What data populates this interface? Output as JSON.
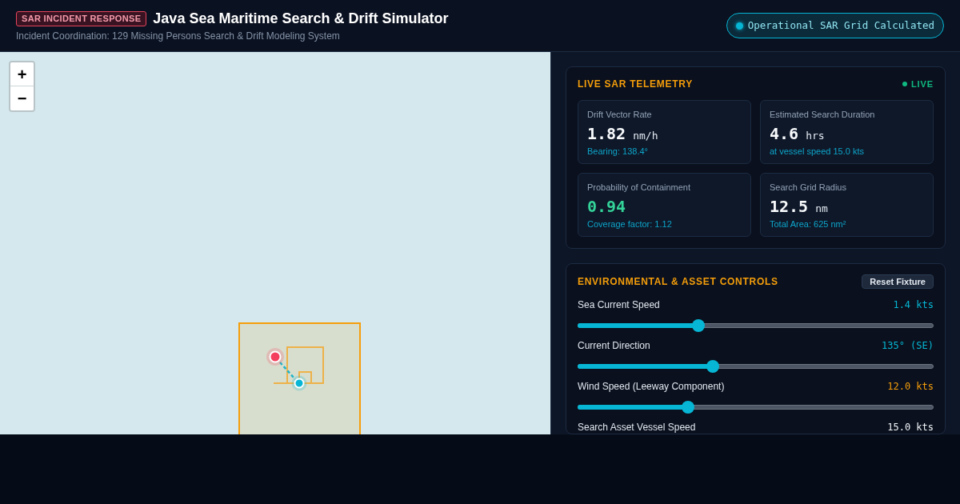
{
  "header": {
    "badge": "SAR INCIDENT RESPONSE",
    "title": "Java Sea Maritime Search & Drift Simulator",
    "subtitle": "Incident Coordination: 129 Missing Persons Search & Drift Modeling System",
    "status": "Operational SAR Grid Calculated"
  },
  "map": {
    "zoom_buttons": [
      "+",
      "−"
    ]
  },
  "telemetry": {
    "title": "LIVE SAR TELEMETRY",
    "live": "LIVE",
    "stats": [
      {
        "label": "Drift Vector Rate",
        "value": "1.82",
        "unit": "nm/h",
        "note": "Bearing: 138.4°",
        "color": "#f8fafc"
      },
      {
        "label": "Estimated Search Duration",
        "value": "4.6",
        "unit": "hrs",
        "note": "at vessel speed 15.0 kts",
        "color": "#f8fafc"
      },
      {
        "label": "Probability of Containment",
        "value": "0.94",
        "note": "Coverage factor: 1.12",
        "color": "#34d399"
      },
      {
        "label": "Search Grid Radius",
        "value": "12.5",
        "unit": "nm",
        "note": "Total Area: 625 nm²",
        "color": "#f8fafc"
      }
    ]
  },
  "controls": {
    "title": "ENVIRONMENTAL & ASSET CONTROLS",
    "reset_button": "Reset Fixture",
    "sliders": [
      {
        "label": "Sea Current Speed",
        "reading": "1.4 kts",
        "color": "#06b6d4",
        "level": 0.34
      },
      {
        "label": "Current Direction",
        "reading": "135° (SE)",
        "color": "#06b6d4",
        "level": 0.38
      },
      {
        "label": "Wind Speed (Leeway Component)",
        "reading": "12.0 kts",
        "color": "#f59e0b",
        "level": 0.31
      },
      {
        "label": "Search Asset Vessel Speed",
        "reading": "15.0 kts",
        "color": "#f1f5f9"
      }
    ]
  }
}
